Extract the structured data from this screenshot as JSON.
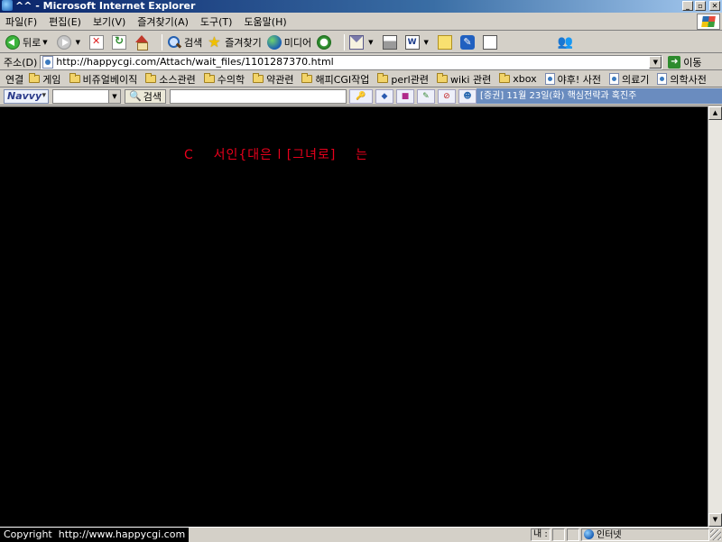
{
  "window": {
    "title": "^^ - Microsoft Internet Explorer",
    "buttons": [
      "_",
      "▫",
      "✕"
    ]
  },
  "menu": [
    "파일(F)",
    "편집(E)",
    "보기(V)",
    "즐겨찾기(A)",
    "도구(T)",
    "도움말(H)"
  ],
  "toolbar": {
    "back_label": "뒤로",
    "search_label": "검색",
    "favorites_label": "즐겨찾기",
    "media_label": "미디어",
    "word_glyph": "W"
  },
  "address": {
    "label": "주소(D)",
    "url": "http://happycgi.com/Attach/wait_files/1101287370.html",
    "go_label": "이동"
  },
  "links": {
    "label": "연결",
    "items": [
      {
        "label": "게임",
        "icon": "folder"
      },
      {
        "label": "비쥬얼베이직",
        "icon": "folder"
      },
      {
        "label": "소스관련",
        "icon": "folder"
      },
      {
        "label": "수의학",
        "icon": "folder"
      },
      {
        "label": "약관련",
        "icon": "folder"
      },
      {
        "label": "해피CGI작업",
        "icon": "folder"
      },
      {
        "label": "perl관련",
        "icon": "folder"
      },
      {
        "label": "wiki 관련",
        "icon": "folder"
      },
      {
        "label": "xbox",
        "icon": "folder"
      },
      {
        "label": "야후! 사전",
        "icon": "page"
      },
      {
        "label": "의료기",
        "icon": "page"
      },
      {
        "label": "의학사전",
        "icon": "page"
      }
    ]
  },
  "navvy": {
    "logo": "Navvy",
    "search_label": "검색",
    "ticker": "[증권] 11월 23일(화) 핵심전략과 혹진주"
  },
  "content": {
    "text": "C    서인{대은 l [그녀로]    는",
    "background": "#000000",
    "text_color": "#e8001c"
  },
  "status": {
    "left_text": "Copyright  http://www.happycgi.com",
    "pane_text": "내 :",
    "zone_text": "인터넷"
  }
}
